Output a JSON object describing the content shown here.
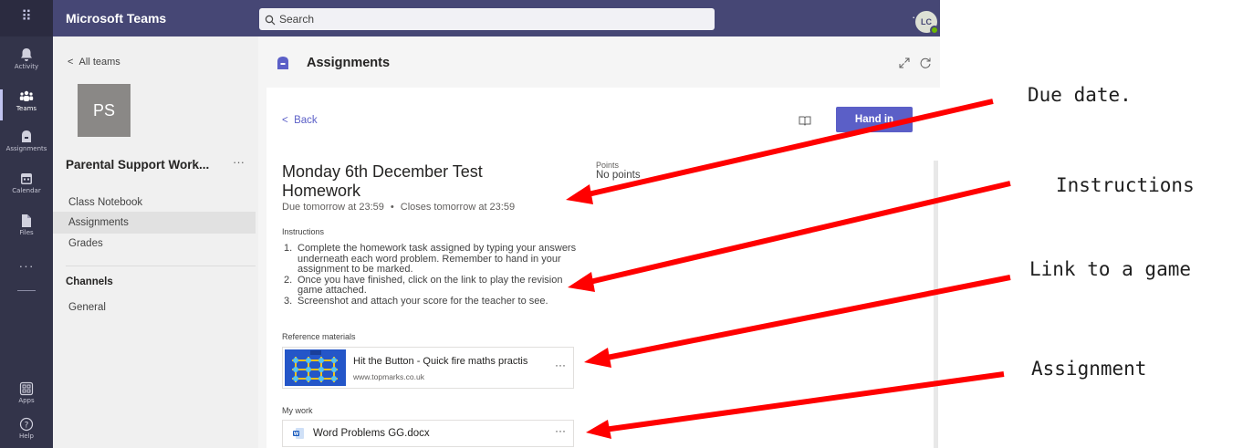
{
  "app": {
    "title": "Microsoft Teams"
  },
  "search": {
    "placeholder": "Search"
  },
  "header": {
    "more": "···",
    "avatar_initials": "LC"
  },
  "rail": {
    "items": [
      {
        "label": "Activity"
      },
      {
        "label": "Teams"
      },
      {
        "label": "Assignments"
      },
      {
        "label": "Calendar"
      },
      {
        "label": "Files"
      },
      {
        "label": "Apps"
      },
      {
        "label": "Help"
      }
    ],
    "more": "···"
  },
  "team_panel": {
    "back": "All teams",
    "team_initials": "PS",
    "team_name": "Parental Support Work...",
    "team_more": "···",
    "items": [
      {
        "label": "Class Notebook"
      },
      {
        "label": "Assignments"
      },
      {
        "label": "Grades"
      }
    ],
    "channels_heading": "Channels",
    "channels": [
      {
        "label": "General"
      }
    ]
  },
  "main": {
    "app_title": "Assignments",
    "back": "Back",
    "hand_in": "Hand in",
    "assignment_title": "Monday 6th December Test Homework",
    "due": "Due tomorrow at 23:59",
    "due_separator": "•",
    "closes": "Closes tomorrow at 23:59",
    "points_label": "Points",
    "points_value": "No points",
    "instructions_label": "Instructions",
    "instructions": [
      {
        "num": "1.",
        "text": "Complete the homework task assigned by typing your answers underneath each word problem. Remember to hand in your assignment to be marked."
      },
      {
        "num": "2.",
        "text": "Once you have finished, click on the link to play the revision game attached."
      },
      {
        "num": "3.",
        "text": "Screenshot and attach your score for the teacher to see."
      }
    ],
    "reference_label": "Reference materials",
    "reference": {
      "title": "Hit the Button - Quick fire maths practis",
      "url": "www.topmarks.co.uk",
      "more": "···"
    },
    "mywork_label": "My work",
    "file": {
      "name": "Word Problems GG.docx",
      "more": "···"
    }
  },
  "annotations": [
    {
      "text": "Due date."
    },
    {
      "text": "Instructions"
    },
    {
      "text": "Link to a game"
    },
    {
      "text": "Assignment"
    }
  ],
  "colors": {
    "rail": "#33344a",
    "topbar": "#464775",
    "accent": "#5b5fc7",
    "arrow": "#ff0000"
  }
}
